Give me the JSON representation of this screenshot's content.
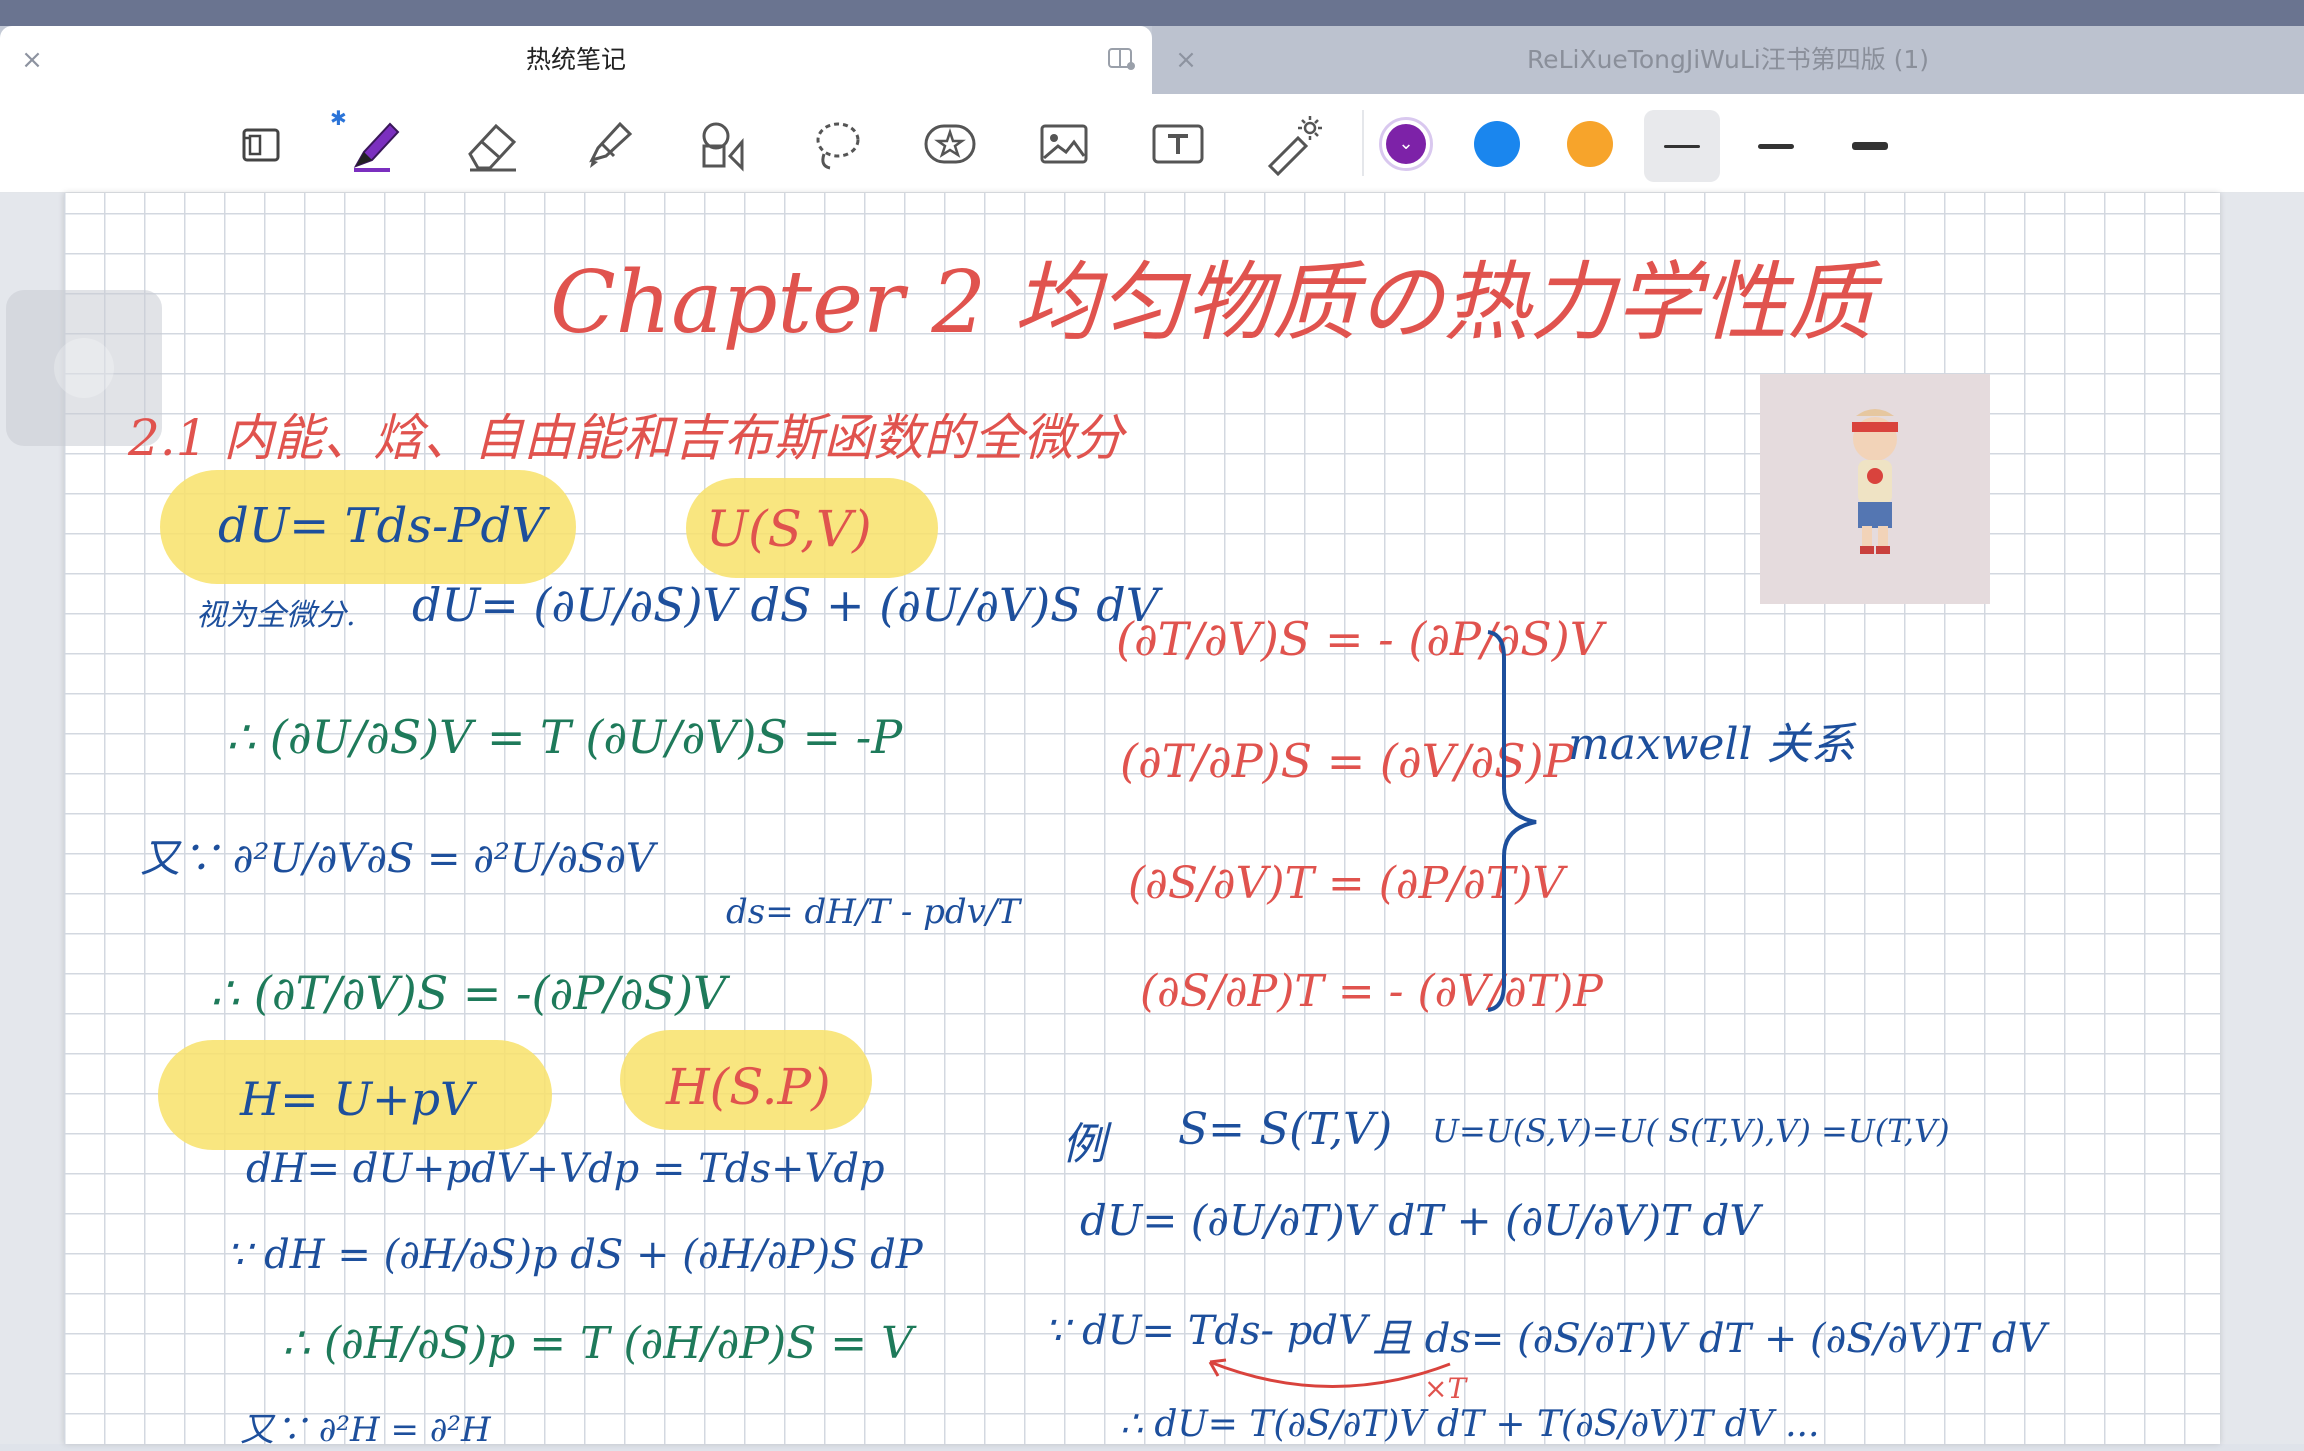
{
  "tabs": [
    {
      "title": "热统笔记",
      "active": true
    },
    {
      "title": "ReLiXueTongJiWuLi汪书第四版 (1)",
      "active": false
    }
  ],
  "toolbar": {
    "tools": [
      "pages-icon",
      "pen-icon",
      "eraser-icon",
      "highlighter-icon",
      "shapes-icon",
      "lasso-icon",
      "sticker-icon",
      "image-icon",
      "text-icon",
      "laser-pointer-icon"
    ],
    "bluetooth_symbol": "✱",
    "colors": [
      "#8a2be2",
      "#1a82f0",
      "#f5a623"
    ],
    "selected_color": "#8a2be2",
    "stroke_widths": [
      "thin",
      "medium",
      "thick"
    ],
    "selected_stroke": "thin"
  },
  "notes": {
    "title": "Chapter 2  均匀物质の热力学性质",
    "section": "2.1 内能、焓、自由能和吉布斯函数的全微分",
    "dU_eq": "dU= Tds-PdV",
    "U_func": "U(S,V)",
    "total_diff_label": "视为全微分.",
    "total_diff": "dU= (∂U/∂S)V dS + (∂U/∂V)S dV",
    "therefore_1": "∴ (∂U/∂S)V = T    (∂U/∂V)S = -P",
    "because_1": "又∵  ∂²U/∂V∂S = ∂²U/∂S∂V",
    "ds_eq": "ds= dH/T - pdv/T",
    "therefore_2": "∴ (∂T/∂V)S = -(∂P/∂S)V",
    "H_eq": "H= U+pV",
    "H_func": "H(S.P)",
    "dH_eq": "dH= dU+pdV+Vdp = Tds+Vdp",
    "dH_diff": "∵ dH = (∂H/∂S)p dS + (∂H/∂P)S dP",
    "therefore_3": "∴ (∂H/∂S)p = T    (∂H/∂P)S = V",
    "because_2": "又∵  ∂²H  =  ∂²H",
    "maxwell": [
      "(∂T/∂V)S = - (∂P/∂S)V",
      "(∂T/∂P)S = (∂V/∂S)P",
      "(∂S/∂V)T = (∂P/∂T)V",
      "(∂S/∂P)T = - (∂V/∂T)P"
    ],
    "maxwell_label": "maxwell 关系",
    "example_label": "例",
    "example_s": "S= S(T,V)",
    "example_u": "U=U(S,V)=U( S(T,V),V) =U(T,V)",
    "example_du": "dU= (∂U/∂T)V dT + (∂U/∂V)T dV",
    "example_line3a": "∵ dU= Tds- pdV",
    "example_line3b": "且  ds= (∂S/∂T)V dT + (∂S/∂V)T dV",
    "times_T": "×T",
    "example_line4": "∴ dU=  T(∂S/∂T)V dT + T(∂S/∂V)T dV ..."
  }
}
